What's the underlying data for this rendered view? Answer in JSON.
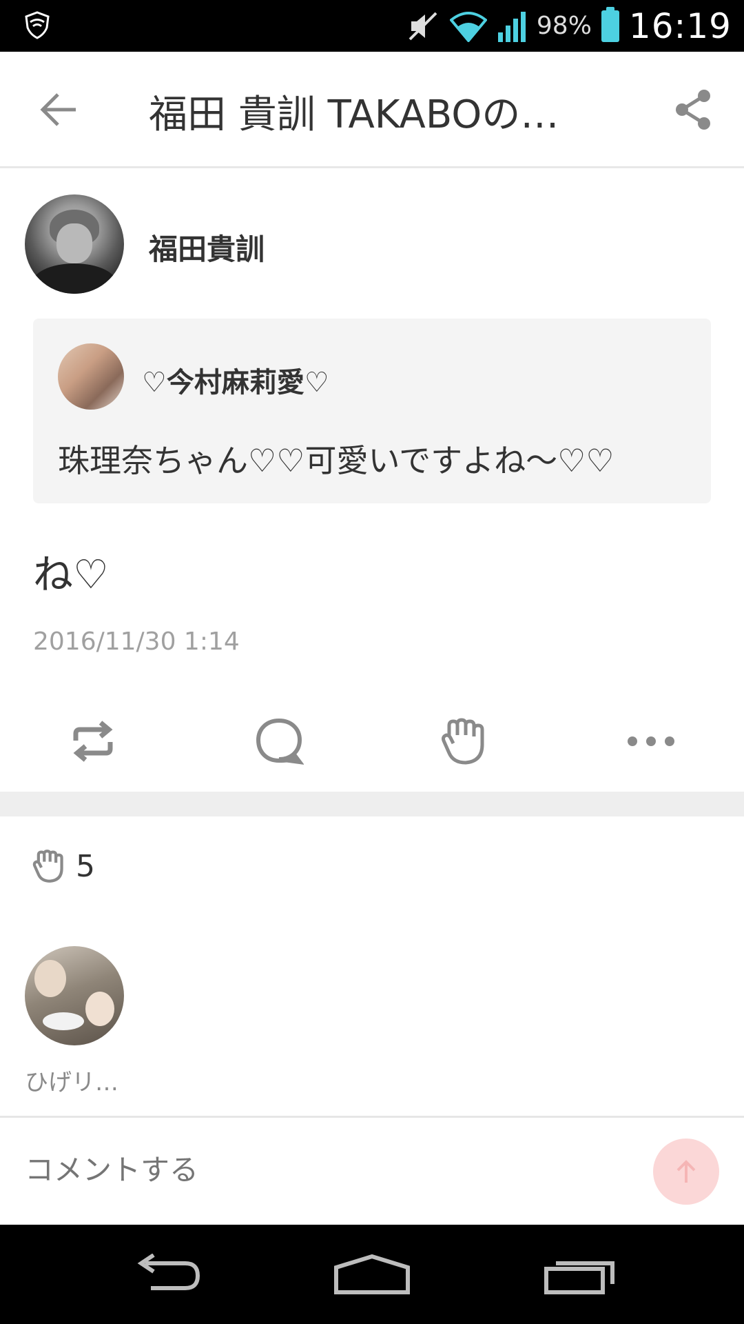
{
  "status_bar": {
    "battery_percent": "98%",
    "time": "16:19",
    "icons": [
      "shield-icon",
      "mute-icon",
      "wifi-icon",
      "signal-icon",
      "battery-icon"
    ]
  },
  "header": {
    "title": "福田 貴訓  TAKABOの…",
    "icons": [
      "back-arrow-icon",
      "share-icon"
    ]
  },
  "post": {
    "author_name": "福田貴訓",
    "quoted": {
      "name": "♡今村麻莉愛♡",
      "text": "珠理奈ちゃん♡♡可愛いですよね〜♡♡"
    },
    "text": "ね♡",
    "timestamp": "2016/11/30 1:14"
  },
  "actions": [
    "repost-icon",
    "comment-icon",
    "clap-icon",
    "more-icon"
  ],
  "likes": {
    "count": "5",
    "users": [
      {
        "name": "ひげリ…"
      }
    ]
  },
  "comment_bar": {
    "placeholder": "コメントする"
  },
  "colors": {
    "icon_gray": "#8a8a8a",
    "send_button": "#fbd7d7",
    "battery": "#4dd0e1",
    "wifi": "#4dd0e1"
  }
}
